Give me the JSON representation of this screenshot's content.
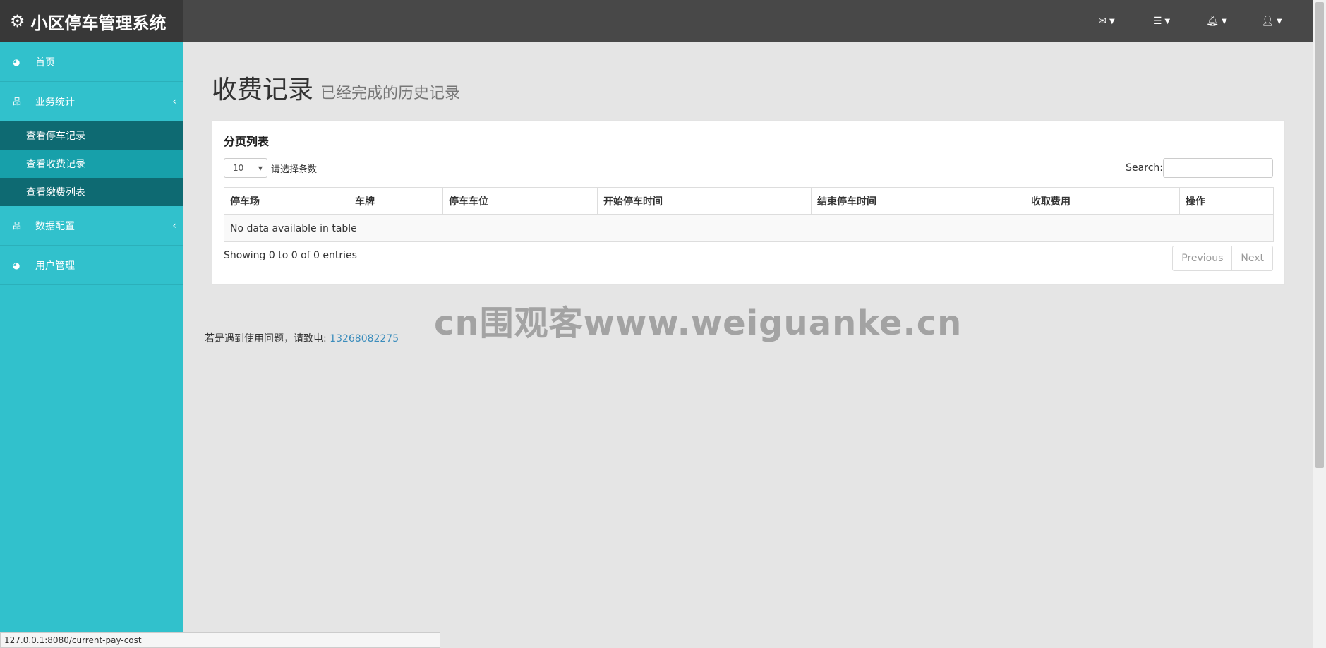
{
  "header": {
    "brand_title": "小区停车管理系统",
    "icons": [
      "envelope-icon",
      "tasks-icon",
      "bell-icon",
      "user-icon"
    ]
  },
  "sidebar": {
    "items": [
      {
        "label": "首页",
        "icon": "dashboard-icon"
      },
      {
        "label": "业务统计",
        "icon": "sitemap-icon",
        "expanded": true
      },
      {
        "label": "数据配置",
        "icon": "sitemap-icon"
      },
      {
        "label": "用户管理",
        "icon": "dashboard-icon"
      }
    ],
    "subitems": [
      {
        "label": "查看停车记录"
      },
      {
        "label": "查看收费记录",
        "active": true
      },
      {
        "label": "查看缴费列表"
      }
    ]
  },
  "page": {
    "title": "收费记录",
    "subtitle": "已经完成的历史记录"
  },
  "panel": {
    "title": "分页列表",
    "length_value": "10",
    "length_label": "请选择条数",
    "search_label": "Search:",
    "columns": [
      "停车场",
      "车牌",
      "停车车位",
      "开始停车时间",
      "结束停车时间",
      "收取费用",
      "操作"
    ],
    "empty_text": "No data available in table",
    "info_text": "Showing 0 to 0 of 0 entries",
    "prev_label": "Previous",
    "next_label": "Next"
  },
  "watermark": "cn围观客www.weiguanke.cn",
  "footer": {
    "text": "若是遇到使用问题，请致电: ",
    "phone": "13268082275"
  },
  "statusbar": {
    "url": "127.0.0.1:8080/current-pay-cost"
  },
  "colors": {
    "sidebar": "#31c1cc",
    "sidebar_active": "#0e6a72",
    "header": "#484848",
    "link": "#3c8dbc"
  }
}
